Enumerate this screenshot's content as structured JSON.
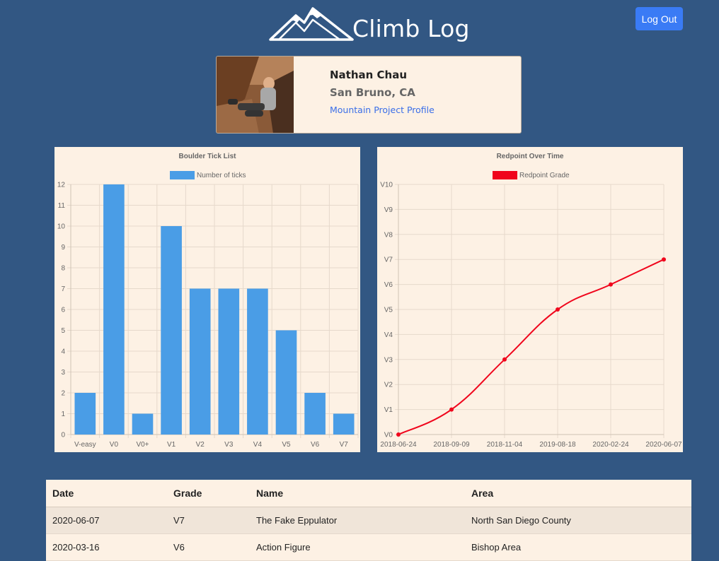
{
  "app": {
    "title": "Climb Log",
    "logout_label": "Log Out",
    "accent_color": "#3a7bf5",
    "background_color": "#325783"
  },
  "profile": {
    "name": "Nathan Chau",
    "location": "San Bruno, CA",
    "link_label": "Mountain Project Profile"
  },
  "chart_data": [
    {
      "type": "bar",
      "title": "Boulder Tick List",
      "categories": [
        "V-easy",
        "V0",
        "V0+",
        "V1",
        "V2",
        "V3",
        "V4",
        "V5",
        "V6",
        "V7"
      ],
      "series": [
        {
          "name": "Number of ticks",
          "values": [
            2,
            12,
            1,
            10,
            7,
            7,
            7,
            5,
            2,
            1
          ],
          "color": "#4a9de6"
        }
      ],
      "ylim": [
        0,
        12
      ],
      "yticks": [
        0,
        1,
        2,
        3,
        4,
        5,
        6,
        7,
        8,
        9,
        10,
        11,
        12
      ],
      "grid": true,
      "legend": "top"
    },
    {
      "type": "line",
      "title": "Redpoint Over Time",
      "x": [
        "2018-06-24",
        "2018-09-09",
        "2018-11-04",
        "2019-08-18",
        "2020-02-24",
        "2020-06-07"
      ],
      "series": [
        {
          "name": "Redpoint Grade",
          "values": [
            0,
            1,
            3,
            5,
            6,
            7
          ],
          "color": "#f0051c"
        }
      ],
      "ylim": [
        0,
        10
      ],
      "ytick_labels": [
        "V0",
        "V1",
        "V2",
        "V3",
        "V4",
        "V5",
        "V6",
        "V7",
        "V8",
        "V9",
        "V10"
      ],
      "grid": true,
      "legend": "top"
    }
  ],
  "table": {
    "headers": [
      "Date",
      "Grade",
      "Name",
      "Area"
    ],
    "rows": [
      [
        "2020-06-07",
        "V7",
        "The Fake Eppulator",
        "North San Diego County"
      ],
      [
        "2020-03-16",
        "V6",
        "Action Figure",
        "Bishop Area"
      ]
    ]
  }
}
